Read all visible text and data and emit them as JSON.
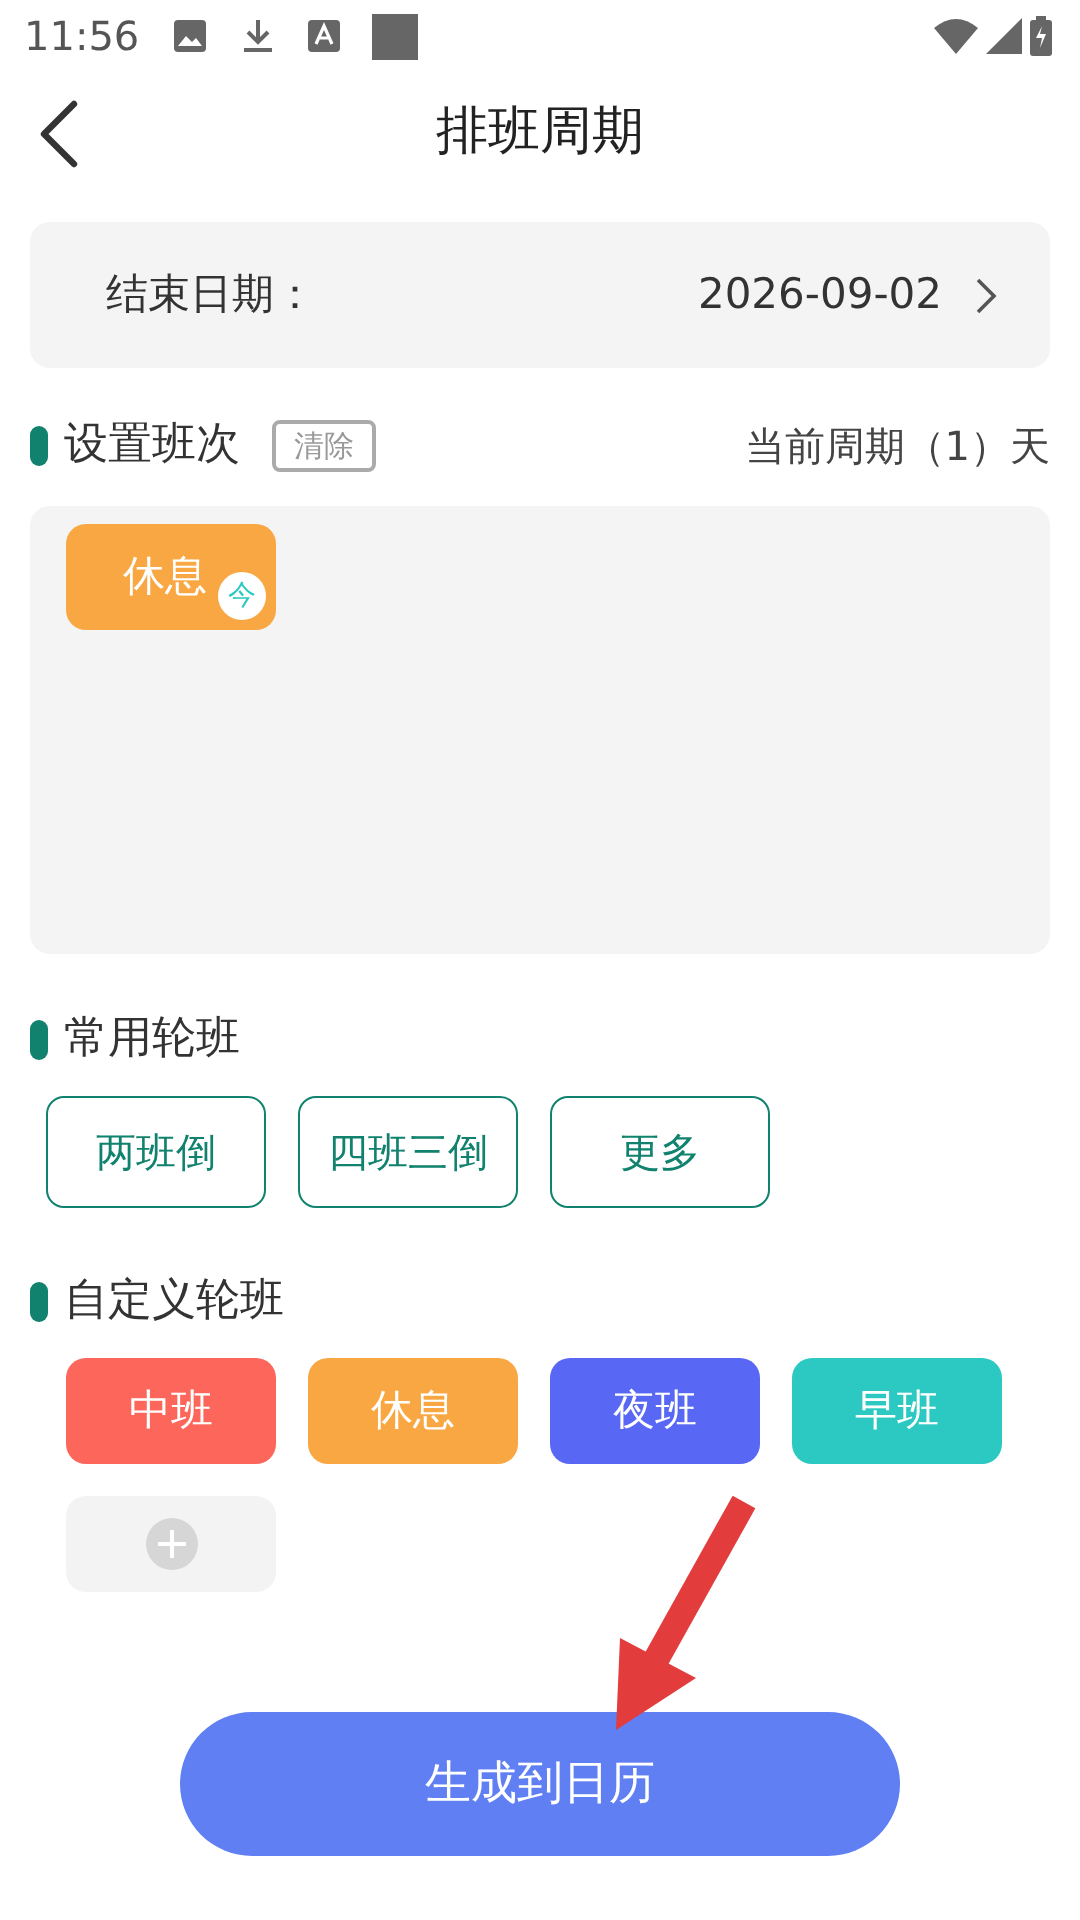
{
  "status_bar": {
    "time": "11:56"
  },
  "header": {
    "title": "排班周期"
  },
  "end_date": {
    "label": "结束日期：",
    "value": "2026-09-02"
  },
  "schedule": {
    "title": "设置班次",
    "clear": "清除",
    "summary": "当前周期（1）天",
    "cycle": [
      {
        "label": "休息",
        "color": "#f9a743",
        "badge": "今"
      }
    ]
  },
  "common": {
    "title": "常用轮班",
    "options": [
      "两班倒",
      "四班三倒",
      "更多"
    ]
  },
  "custom": {
    "title": "自定义轮班",
    "shifts": [
      {
        "label": "中班",
        "color": "#fc665b"
      },
      {
        "label": "休息",
        "color": "#f9a743"
      },
      {
        "label": "夜班",
        "color": "#5867f4"
      },
      {
        "label": "早班",
        "color": "#2cc9c2"
      }
    ]
  },
  "submit": {
    "label": "生成到日历"
  }
}
